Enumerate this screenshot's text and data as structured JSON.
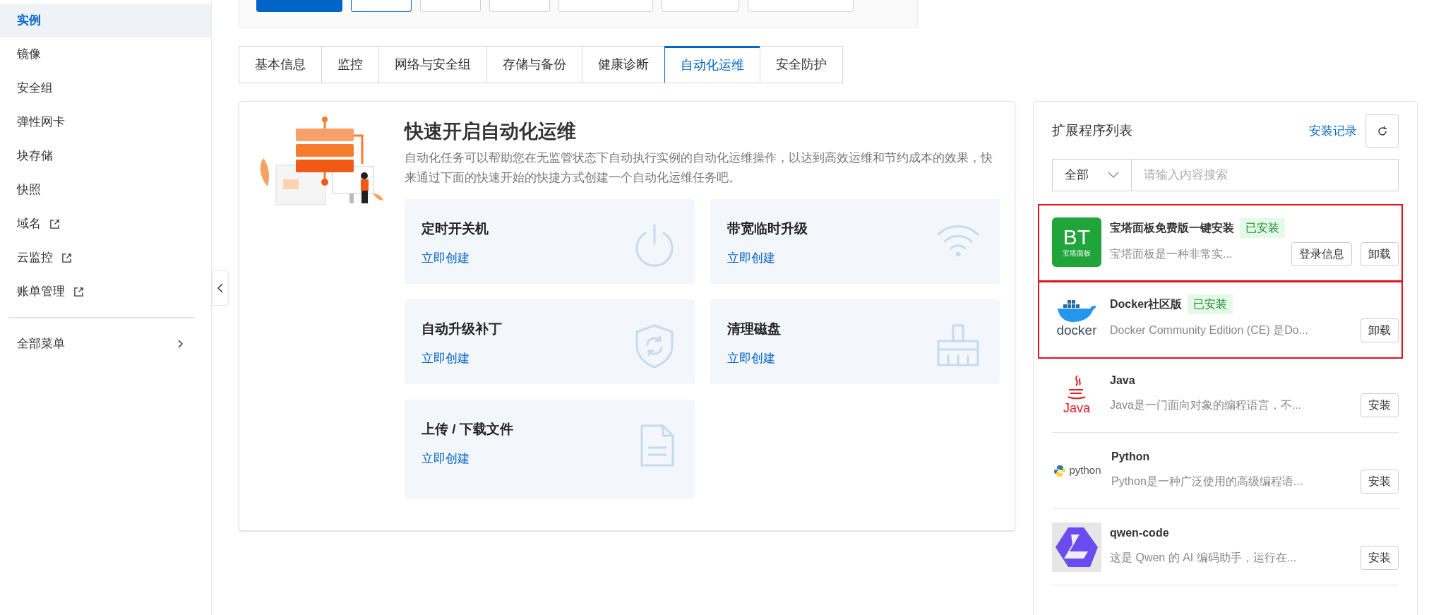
{
  "sidebar": {
    "items": [
      {
        "label": "实例",
        "selected": true,
        "external": false
      },
      {
        "label": "镜像",
        "selected": false,
        "external": false
      },
      {
        "label": "安全组",
        "selected": false,
        "external": false
      },
      {
        "label": "弹性网卡",
        "selected": false,
        "external": false
      },
      {
        "label": "块存储",
        "selected": false,
        "external": false
      },
      {
        "label": "快照",
        "selected": false,
        "external": false
      },
      {
        "label": "域名",
        "selected": false,
        "external": true
      },
      {
        "label": "云监控",
        "selected": false,
        "external": true
      },
      {
        "label": "账单管理",
        "selected": false,
        "external": true
      }
    ],
    "all_menu": "全部菜单"
  },
  "toolbar": {
    "buttons": [
      {
        "kind": "primary"
      },
      {
        "kind": "outlined"
      },
      {
        "kind": "default"
      },
      {
        "kind": "default"
      },
      {
        "kind": "default"
      },
      {
        "kind": "default"
      },
      {
        "kind": "default"
      }
    ]
  },
  "tabs": [
    {
      "label": "基本信息",
      "selected": false
    },
    {
      "label": "监控",
      "selected": false
    },
    {
      "label": "网络与安全组",
      "selected": false
    },
    {
      "label": "存储与备份",
      "selected": false
    },
    {
      "label": "健康诊断",
      "selected": false
    },
    {
      "label": "自动化运维",
      "selected": true
    },
    {
      "label": "安全防护",
      "selected": false
    }
  ],
  "quick_start": {
    "title": "快速开启自动化运维",
    "description": "自动化任务可以帮助您在无监管状态下自动执行实例的自动化运维操作，以达到高效运维和节约成本的效果，快来通过下面的快速开始的快捷方式创建一个自动化运维任务吧。",
    "cards": [
      {
        "title": "定时开关机",
        "link": "立即创建",
        "kind": "power"
      },
      {
        "title": "带宽临时升级",
        "link": "立即创建",
        "kind": "wifi"
      },
      {
        "title": "自动升级补丁",
        "link": "立即创建",
        "kind": "shield"
      },
      {
        "title": "清理磁盘",
        "link": "立即创建",
        "kind": "broom"
      },
      {
        "title": "上传 / 下载文件",
        "link": "立即创建",
        "kind": "file"
      }
    ]
  },
  "extensions": {
    "title": "扩展程序列表",
    "history_link": "安装记录",
    "filter": {
      "value": "全部"
    },
    "search": {
      "placeholder": "请输入内容搜索"
    },
    "items": [
      {
        "name": "宝塔面板免费版一键安装",
        "badge": "已安装",
        "description": "宝塔面板是一种非常实...",
        "logo": {
          "kind": "bt",
          "text": "BT",
          "subtext": "宝塔面板"
        },
        "actions": [
          "登录信息",
          "卸载"
        ],
        "highlighted": true
      },
      {
        "name": "Docker社区版",
        "badge": "已安装",
        "description": "Docker Community Edition (CE) 是Do...",
        "logo": {
          "kind": "docker",
          "text": "docker"
        },
        "actions": [
          "卸载"
        ],
        "highlighted": true
      },
      {
        "name": "Java",
        "description": "Java是一门面向对象的编程语言，不...",
        "logo": {
          "kind": "java",
          "text": "Java"
        },
        "actions": [
          "安装"
        ],
        "highlighted": false
      },
      {
        "name": "Python",
        "description": "Python是一种广泛使用的高级编程语...",
        "logo": {
          "kind": "python",
          "text": "python"
        },
        "actions": [
          "安装"
        ],
        "highlighted": false
      },
      {
        "name": "qwen-code",
        "description": "这是 Qwen 的 AI 编码助手，运行在...",
        "logo": {
          "kind": "qwen"
        },
        "actions": [
          "安装"
        ],
        "highlighted": false
      }
    ]
  }
}
